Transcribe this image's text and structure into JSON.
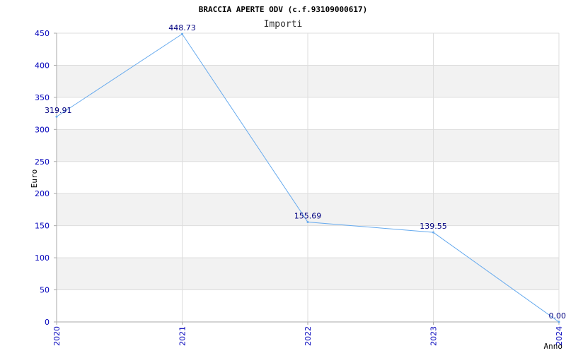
{
  "chart_data": {
    "type": "line",
    "title": "BRACCIA APERTE ODV (c.f.93109000617)",
    "subtitle": "Importi",
    "xlabel": "Anno",
    "ylabel": "Euro",
    "categories": [
      "2020",
      "2021",
      "2022",
      "2023",
      "2024"
    ],
    "series": [
      {
        "values": [
          319.91,
          448.73,
          155.69,
          139.55,
          0.0
        ]
      }
    ],
    "data_labels": [
      "319.91",
      "448.73",
      "155.69",
      "139.55",
      "0.00"
    ],
    "ylim": [
      0,
      450
    ],
    "yticks": [
      0,
      50,
      100,
      150,
      200,
      250,
      300,
      350,
      400,
      450
    ],
    "grid": true,
    "colors": {
      "line": "#66aaee",
      "band": "#f2f2f2",
      "grid": "#dddddd",
      "axis": "#aaaaaa",
      "tick_label": "#0000bb",
      "data_label": "#000080",
      "title": "#000000"
    }
  }
}
